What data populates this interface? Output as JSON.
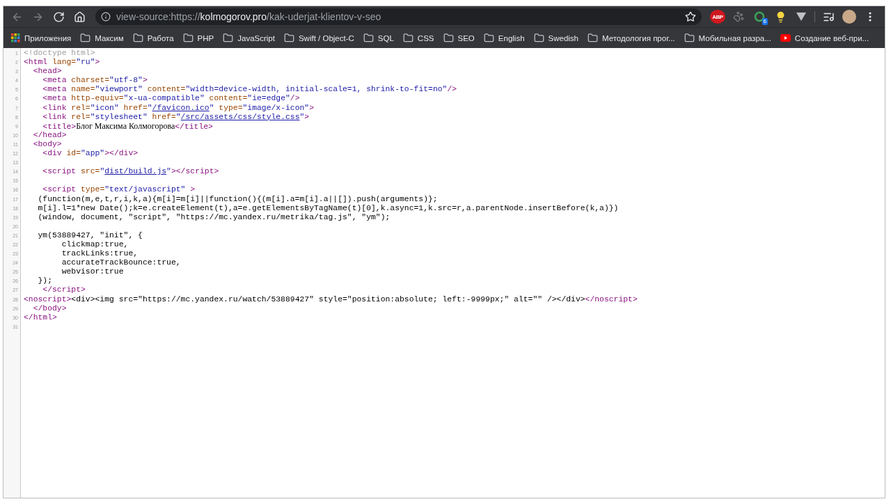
{
  "toolbar": {
    "nav_buttons": [
      {
        "kind": "back",
        "disabled": true
      },
      {
        "kind": "forward",
        "disabled": true
      },
      {
        "kind": "reload",
        "disabled": false
      },
      {
        "kind": "home",
        "disabled": false
      }
    ],
    "url": {
      "scheme": "view-source:https://",
      "host": "kolmogorov.pro",
      "path": "/kak-uderjat-klientov-v-seo"
    },
    "extensions": [
      {
        "kind": "abp",
        "label": "ABP"
      },
      {
        "kind": "paw"
      },
      {
        "kind": "green",
        "badge": "6"
      },
      {
        "kind": "bulb"
      },
      {
        "kind": "vee"
      }
    ]
  },
  "bookmarks": [
    {
      "kind": "apps",
      "label": "Приложения"
    },
    {
      "kind": "folder",
      "label": "Максим"
    },
    {
      "kind": "folder",
      "label": "Работа"
    },
    {
      "kind": "folder",
      "label": "PHP"
    },
    {
      "kind": "folder",
      "label": "JavaScript"
    },
    {
      "kind": "folder",
      "label": "Swift / Object-C"
    },
    {
      "kind": "folder",
      "label": "SQL"
    },
    {
      "kind": "folder",
      "label": "CSS"
    },
    {
      "kind": "folder",
      "label": "SEO"
    },
    {
      "kind": "folder",
      "label": "English"
    },
    {
      "kind": "folder",
      "label": "Swedish"
    },
    {
      "kind": "folder",
      "label": "Методология прог..."
    },
    {
      "kind": "folder",
      "label": "Мобильная разра..."
    },
    {
      "kind": "video",
      "label": "Создание веб-при..."
    }
  ],
  "source_lines": [
    {
      "number": "1",
      "tokens": [
        {
          "kind": "comment",
          "text": "<!doctype html>"
        }
      ]
    },
    {
      "number": "2",
      "tokens": [
        {
          "kind": "tag",
          "text": "<html"
        },
        {
          "kind": "attr",
          "text": " lang="
        },
        {
          "kind": "value",
          "text": "\"ru\""
        },
        {
          "kind": "tag",
          "text": ">"
        }
      ]
    },
    {
      "number": "3",
      "tokens": [
        {
          "kind": "tag",
          "text": "  <head>"
        }
      ]
    },
    {
      "number": "4",
      "tokens": [
        {
          "kind": "tag",
          "text": "    <meta"
        },
        {
          "kind": "attr",
          "text": " charset="
        },
        {
          "kind": "value",
          "text": "\"utf-8\""
        },
        {
          "kind": "tag",
          "text": ">"
        }
      ]
    },
    {
      "number": "5",
      "tokens": [
        {
          "kind": "tag",
          "text": "    <meta"
        },
        {
          "kind": "attr",
          "text": " name="
        },
        {
          "kind": "value",
          "text": "\"viewport\""
        },
        {
          "kind": "attr",
          "text": " content="
        },
        {
          "kind": "value",
          "text": "\"width=device-width, initial-scale=1, shrink-to-fit=no\""
        },
        {
          "kind": "tag",
          "text": "/>"
        }
      ]
    },
    {
      "number": "6",
      "tokens": [
        {
          "kind": "tag",
          "text": "    <meta"
        },
        {
          "kind": "attr",
          "text": " http-equiv="
        },
        {
          "kind": "value",
          "text": "\"x-ua-compatible\""
        },
        {
          "kind": "attr",
          "text": " content="
        },
        {
          "kind": "value",
          "text": "\"ie=edge\""
        },
        {
          "kind": "tag",
          "text": "/>"
        }
      ]
    },
    {
      "number": "7",
      "tokens": [
        {
          "kind": "tag",
          "text": "    <link"
        },
        {
          "kind": "attr",
          "text": " rel="
        },
        {
          "kind": "value",
          "text": "\"icon\""
        },
        {
          "kind": "attr",
          "text": " href="
        },
        {
          "kind": "value",
          "text": "\""
        },
        {
          "kind": "link",
          "text": "/favicon.ico"
        },
        {
          "kind": "value",
          "text": "\""
        },
        {
          "kind": "attr",
          "text": " type="
        },
        {
          "kind": "value",
          "text": "\"image/x-icon\""
        },
        {
          "kind": "tag",
          "text": ">"
        }
      ]
    },
    {
      "number": "8",
      "tokens": [
        {
          "kind": "tag",
          "text": "    <link"
        },
        {
          "kind": "attr",
          "text": " rel="
        },
        {
          "kind": "value",
          "text": "\"stylesheet\""
        },
        {
          "kind": "attr",
          "text": " href="
        },
        {
          "kind": "value",
          "text": "\""
        },
        {
          "kind": "link",
          "text": "/src/assets/css/style.css"
        },
        {
          "kind": "value",
          "text": "\""
        },
        {
          "kind": "tag",
          "text": ">"
        }
      ]
    },
    {
      "number": "9",
      "tokens": [
        {
          "kind": "tag",
          "text": "    <title>"
        },
        {
          "kind": "text",
          "text": "Блог Максима Колмогорова"
        },
        {
          "kind": "tag",
          "text": "</title>"
        }
      ]
    },
    {
      "number": "10",
      "tokens": [
        {
          "kind": "tag",
          "text": "  </head>"
        }
      ]
    },
    {
      "number": "11",
      "tokens": [
        {
          "kind": "tag",
          "text": "  <body>"
        }
      ]
    },
    {
      "number": "12",
      "tokens": [
        {
          "kind": "tag",
          "text": "    <div"
        },
        {
          "kind": "attr",
          "text": " id="
        },
        {
          "kind": "value",
          "text": "\"app\""
        },
        {
          "kind": "tag",
          "text": "></div>"
        }
      ]
    },
    {
      "number": "13"
    },
    {
      "number": "14",
      "tokens": [
        {
          "kind": "tag",
          "text": "    <script"
        },
        {
          "kind": "attr",
          "text": " src="
        },
        {
          "kind": "value",
          "text": "\""
        },
        {
          "kind": "link",
          "text": "dist/build.js"
        },
        {
          "kind": "value",
          "text": "\""
        },
        {
          "kind": "tag",
          "text": "></script>"
        }
      ]
    },
    {
      "number": "15"
    },
    {
      "number": "16",
      "tokens": [
        {
          "kind": "tag",
          "text": "    <script"
        },
        {
          "kind": "attr",
          "text": " type="
        },
        {
          "kind": "value",
          "text": "\"text/javascript\""
        },
        {
          "kind": "tag",
          "text": " >"
        }
      ]
    },
    {
      "number": "17",
      "tokens": [
        {
          "kind": "plain",
          "text": "   (function(m,e,t,r,i,k,a){m[i]=m[i]||function(){(m[i].a=m[i].a||[]).push(arguments)};"
        }
      ]
    },
    {
      "number": "18",
      "tokens": [
        {
          "kind": "plain",
          "text": "   m[i].l=1*new Date();k=e.createElement(t),a=e.getElementsByTagName(t)[0],k.async=1,k.src=r,a.parentNode.insertBefore(k,a)})"
        }
      ]
    },
    {
      "number": "19",
      "tokens": [
        {
          "kind": "plain",
          "text": "   (window, document, \"script\", \"https://mc.yandex.ru/metrika/tag.js\", \"ym\");"
        }
      ]
    },
    {
      "number": "20"
    },
    {
      "number": "21",
      "tokens": [
        {
          "kind": "plain",
          "text": "   ym(53889427, \"init\", {"
        }
      ]
    },
    {
      "number": "22",
      "tokens": [
        {
          "kind": "plain",
          "text": "        clickmap:true,"
        }
      ]
    },
    {
      "number": "23",
      "tokens": [
        {
          "kind": "plain",
          "text": "        trackLinks:true,"
        }
      ]
    },
    {
      "number": "24",
      "tokens": [
        {
          "kind": "plain",
          "text": "        accurateTrackBounce:true,"
        }
      ]
    },
    {
      "number": "25",
      "tokens": [
        {
          "kind": "plain",
          "text": "        webvisor:true"
        }
      ]
    },
    {
      "number": "26",
      "tokens": [
        {
          "kind": "plain",
          "text": "   });"
        }
      ]
    },
    {
      "number": "27",
      "tokens": [
        {
          "kind": "tag",
          "text": "    </script>"
        }
      ]
    },
    {
      "number": "28",
      "tokens": [
        {
          "kind": "tag",
          "text": "<noscript>"
        },
        {
          "kind": "plain",
          "text": "<div><img src=\"https://mc.yandex.ru/watch/53889427\" style=\"position:absolute; left:-9999px;\" alt=\"\" /></div>"
        },
        {
          "kind": "tag",
          "text": "</noscript>"
        }
      ]
    },
    {
      "number": "29",
      "tokens": [
        {
          "kind": "tag",
          "text": "  </body>"
        }
      ]
    },
    {
      "number": "30",
      "tokens": [
        {
          "kind": "tag",
          "text": "</html>"
        }
      ]
    },
    {
      "number": "31"
    }
  ]
}
